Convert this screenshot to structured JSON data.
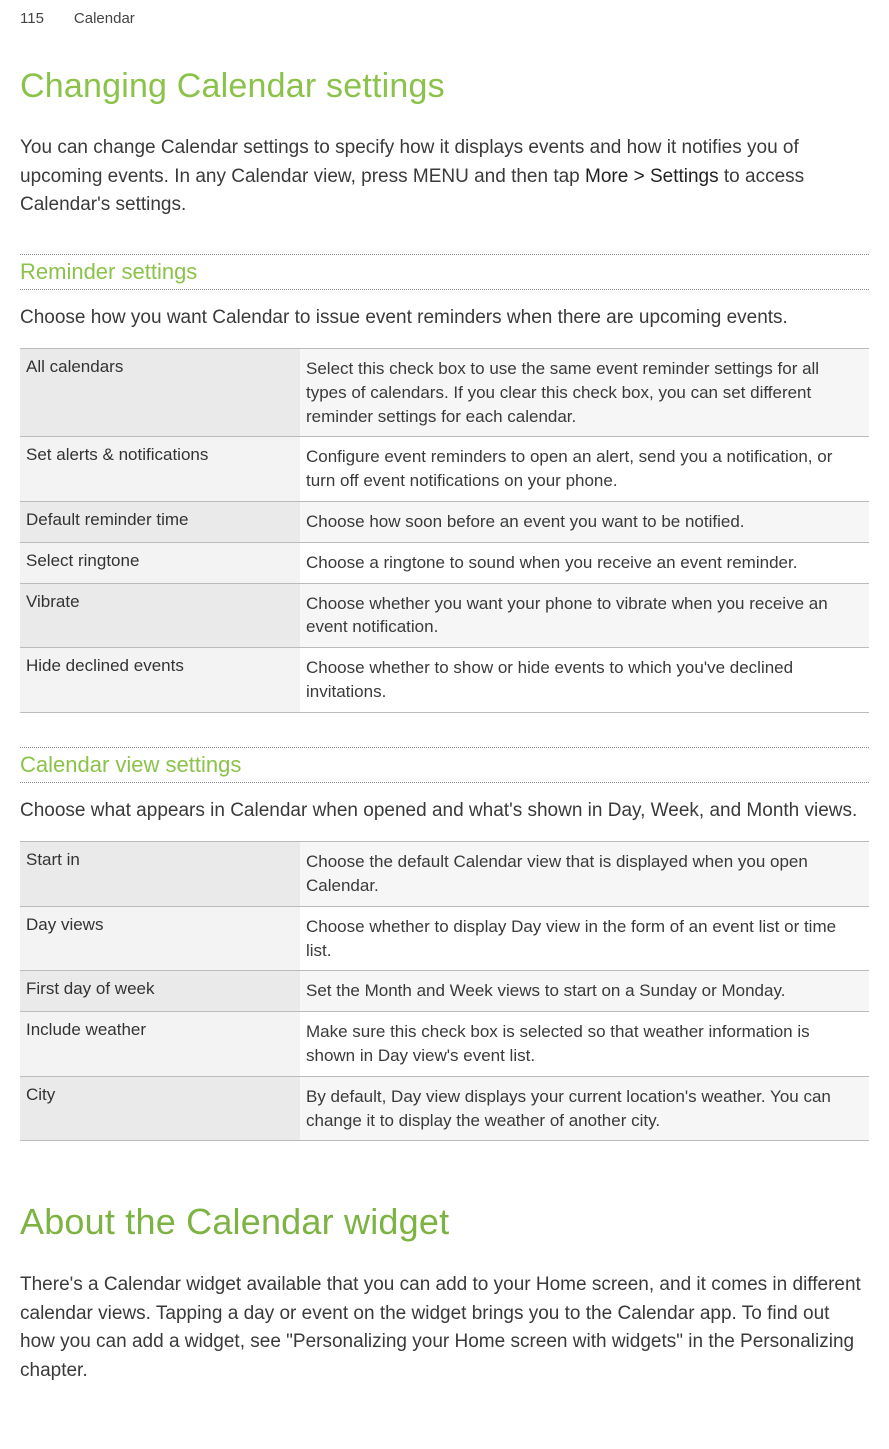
{
  "header": {
    "page": "115",
    "section": "Calendar"
  },
  "h1": "Changing Calendar settings",
  "intro_a": "You can change Calendar settings to specify how it displays events and how it notifies you of upcoming events. In any Calendar view, press MENU and then tap ",
  "intro_bold": "More > Settings",
  "intro_b": " to access Calendar's settings.",
  "reminder": {
    "heading": "Reminder settings",
    "para": "Choose how you want Calendar to issue event reminders when there are upcoming events.",
    "rows": [
      {
        "label": "All calendars",
        "desc": "Select this check box to use the same event reminder settings for all types of calendars. If you clear this check box, you can set different reminder settings for each calendar."
      },
      {
        "label": "Set alerts & notifications",
        "desc": "Configure event reminders to open an alert, send you a notification, or turn off event notifications on your phone."
      },
      {
        "label": "Default reminder time",
        "desc": "Choose how soon before an event you want to be notified."
      },
      {
        "label": "Select ringtone",
        "desc": "Choose a ringtone to sound when you receive an event reminder."
      },
      {
        "label": "Vibrate",
        "desc": "Choose whether you want your phone to vibrate when you receive an event notification."
      },
      {
        "label": "Hide declined events",
        "desc": "Choose whether to show or hide events to which you've declined invitations."
      }
    ]
  },
  "viewsettings": {
    "heading": "Calendar view settings",
    "para": "Choose what appears in Calendar when opened and what's shown in Day, Week, and Month views.",
    "rows": [
      {
        "label": "Start in",
        "desc": "Choose the default Calendar view that is displayed when you open Calendar."
      },
      {
        "label": "Day views",
        "desc": "Choose whether to display Day view in the form of an event list or time list."
      },
      {
        "label": "First day of week",
        "desc": "Set the Month and Week views to start on a Sunday or Monday."
      },
      {
        "label": "Include weather",
        "desc": "Make sure this check box is selected so that weather information is shown in Day view's event list."
      },
      {
        "label": "City",
        "desc": "By default, Day view displays your current location's weather. You can change it to display the weather of another city."
      }
    ]
  },
  "about": {
    "heading": "About the Calendar widget",
    "para": "There's a Calendar widget available that you can add to your Home screen, and it comes in different calendar views. Tapping a day or event on the widget brings you to the Calendar app. To find out how you can add a widget, see \"Personalizing your Home screen with widgets\" in the Personalizing chapter."
  }
}
